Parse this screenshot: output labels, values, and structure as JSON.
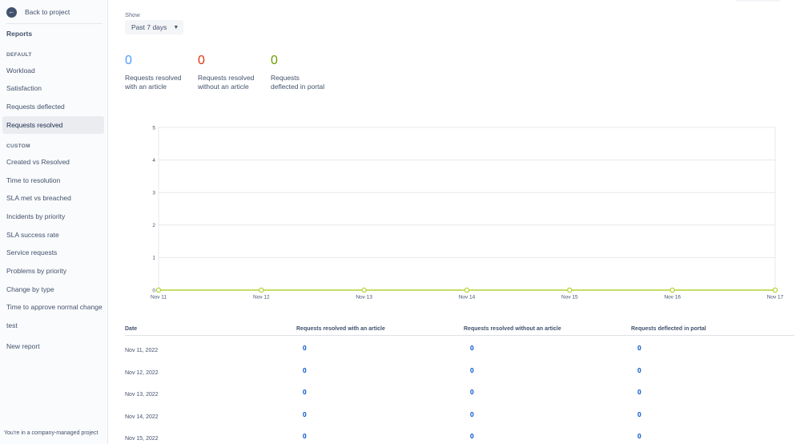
{
  "sidebar": {
    "back_label": "Back to project",
    "title": "Reports",
    "default_section": "DEFAULT",
    "default_items": [
      {
        "label": "Workload"
      },
      {
        "label": "Satisfaction"
      },
      {
        "label": "Requests deflected"
      },
      {
        "label": "Requests resolved",
        "active": true
      }
    ],
    "custom_section": "CUSTOM",
    "custom_items": [
      {
        "label": "Created vs Resolved"
      },
      {
        "label": "Time to resolution"
      },
      {
        "label": "SLA met vs breached"
      },
      {
        "label": "Incidents by priority"
      },
      {
        "label": "SLA success rate"
      },
      {
        "label": "Service requests"
      },
      {
        "label": "Problems by priority"
      },
      {
        "label": "Change by type"
      },
      {
        "label": "Time to approve normal change"
      },
      {
        "label": "test"
      }
    ],
    "new_report_label": "New report",
    "footer": "You're in a company-managed project"
  },
  "filter": {
    "label": "Show",
    "value": "Past 7 days"
  },
  "stats": [
    {
      "value": "0",
      "label_line1": "Requests resolved",
      "label_line2": "with an article",
      "color": "#4c9aff"
    },
    {
      "value": "0",
      "label_line1": "Requests resolved",
      "label_line2": "without an article",
      "color": "#de350b"
    },
    {
      "value": "0",
      "label_line1": "Requests",
      "label_line2": "deflected in portal",
      "color": "#6b9e00"
    }
  ],
  "chart_data": {
    "type": "line",
    "categories": [
      "Nov 11",
      "Nov 12",
      "Nov 13",
      "Nov 14",
      "Nov 15",
      "Nov 16",
      "Nov 17"
    ],
    "y_ticks": [
      "0",
      "1",
      "2",
      "3",
      "4",
      "5"
    ],
    "ylim": [
      0,
      5
    ],
    "grid": true,
    "series": [
      {
        "values": [
          0,
          0,
          0,
          0,
          0,
          0,
          0
        ],
        "color": "#b3d335"
      }
    ]
  },
  "table": {
    "headers": [
      "Date",
      "Requests resolved with an article",
      "Requests resolved without an article",
      "Requests deflected in portal"
    ],
    "rows": [
      {
        "date": "Nov 11, 2022",
        "with": "0",
        "without": "0",
        "deflected": "0"
      },
      {
        "date": "Nov 12, 2022",
        "with": "0",
        "without": "0",
        "deflected": "0"
      },
      {
        "date": "Nov 13, 2022",
        "with": "0",
        "without": "0",
        "deflected": "0"
      },
      {
        "date": "Nov 14, 2022",
        "with": "0",
        "without": "0",
        "deflected": "0"
      },
      {
        "date": "Nov 15, 2022",
        "with": "0",
        "without": "0",
        "deflected": "0"
      }
    ]
  }
}
